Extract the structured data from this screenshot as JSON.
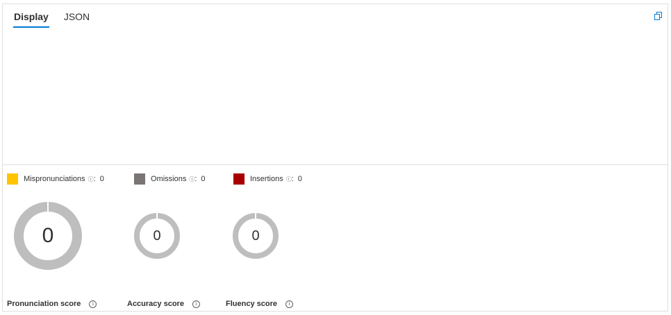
{
  "tabs": [
    {
      "label": "Display",
      "active": true
    },
    {
      "label": "JSON",
      "active": false
    }
  ],
  "toolbar": {
    "copy_icon": "copy-icon"
  },
  "legend": [
    {
      "label": "Mispronunciations",
      "value": "0",
      "color": "#ffc400"
    },
    {
      "label": "Omissions",
      "value": "0",
      "color": "#7a7574"
    },
    {
      "label": "Insertions",
      "value": "0",
      "color": "#a80000"
    }
  ],
  "scores": [
    {
      "label": "Pronunciation score",
      "value": "0"
    },
    {
      "label": "Accuracy score",
      "value": "0"
    },
    {
      "label": "Fluency score",
      "value": "0"
    }
  ],
  "colors": {
    "accent": "#0078d4",
    "donut_track": "#bebebe"
  }
}
